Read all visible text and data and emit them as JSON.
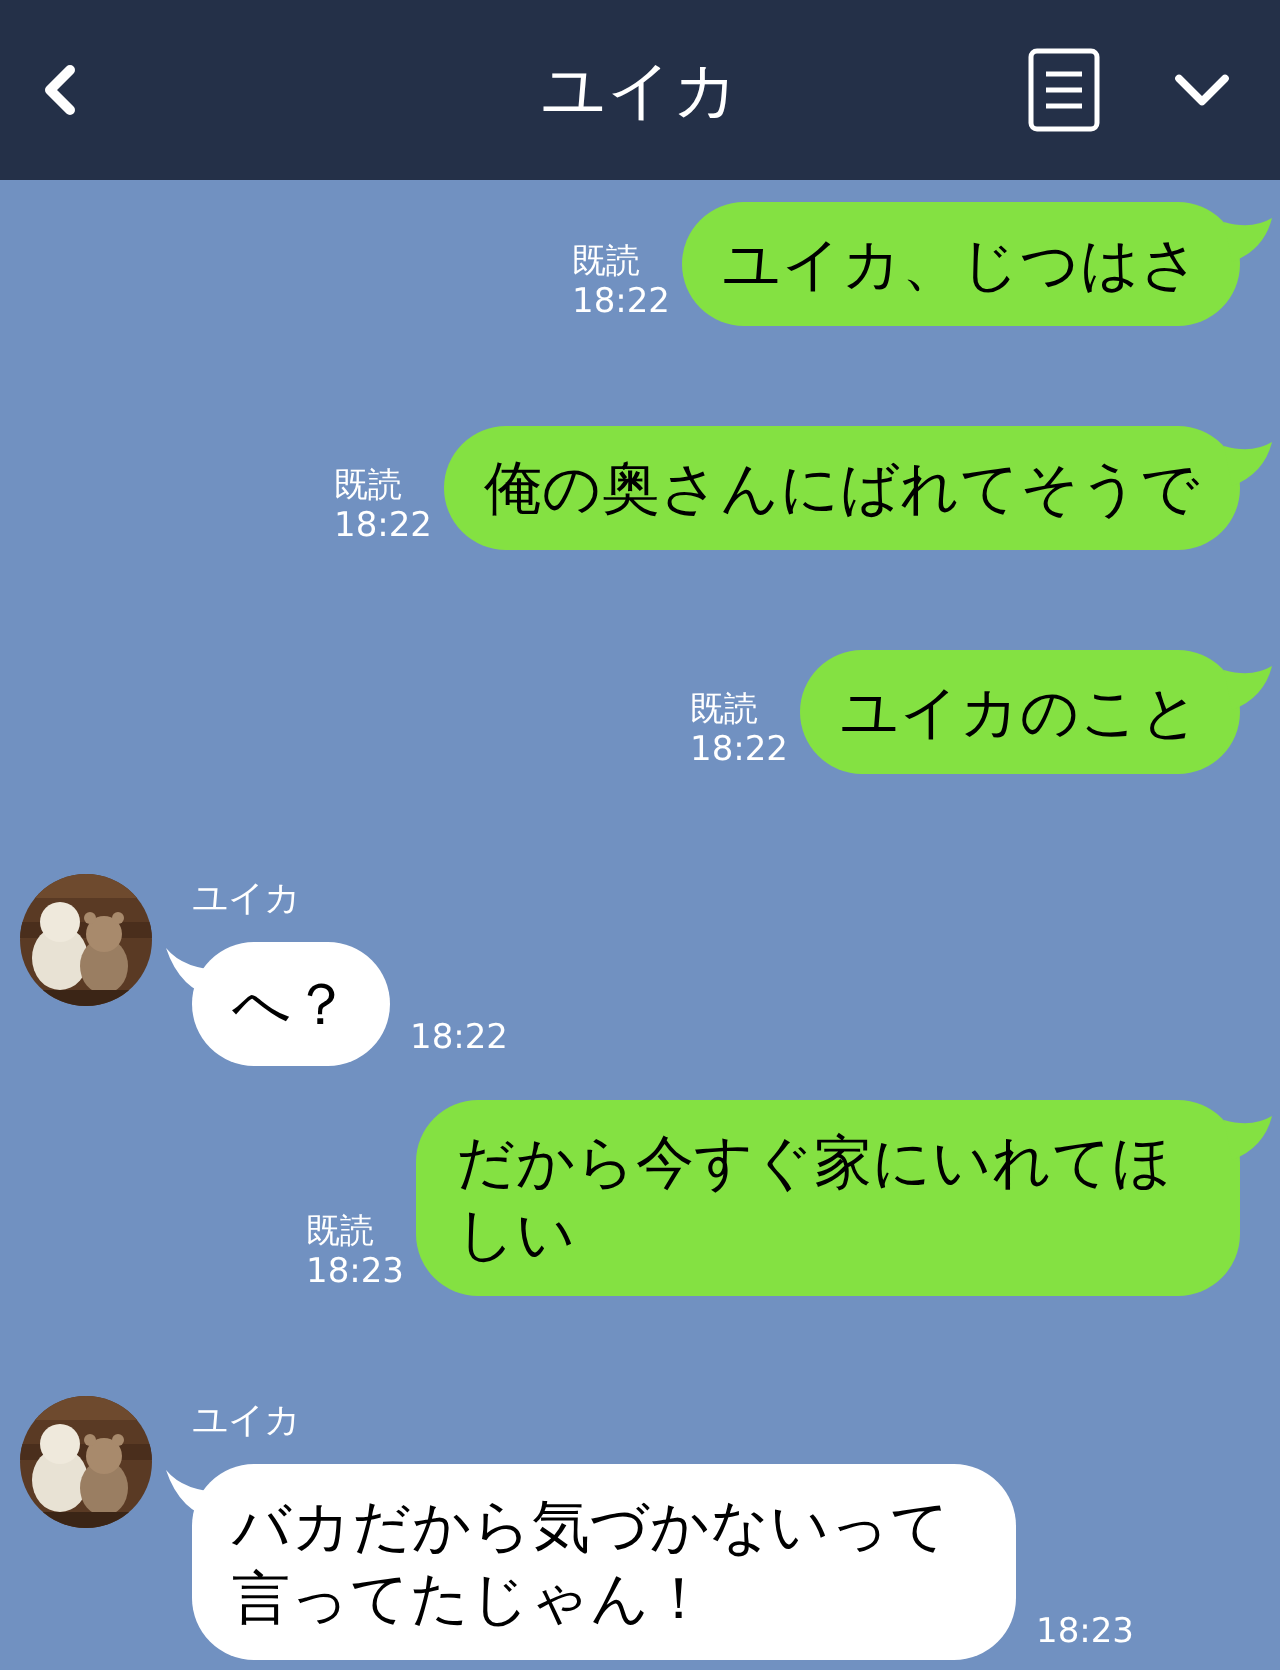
{
  "header": {
    "title": "ユイカ"
  },
  "messages": [
    {
      "kind": "sent",
      "text": "ユイカ、じつはさ",
      "read": "既読",
      "time": "18:22"
    },
    {
      "kind": "sent",
      "text": "俺の奥さんにばれてそうで",
      "read": "既読",
      "time": "18:22"
    },
    {
      "kind": "sent",
      "text": "ユイカのこと",
      "read": "既読",
      "time": "18:22"
    },
    {
      "kind": "received",
      "name": "ユイカ",
      "text": "へ？",
      "time": "18:22"
    },
    {
      "kind": "sent",
      "text": "だから今すぐ家にいれてほしい",
      "read": "既読",
      "time": "18:23"
    },
    {
      "kind": "received",
      "name": "ユイカ",
      "text": "バカだから気づかないって言ってたじゃん！",
      "time": "18:23"
    }
  ]
}
